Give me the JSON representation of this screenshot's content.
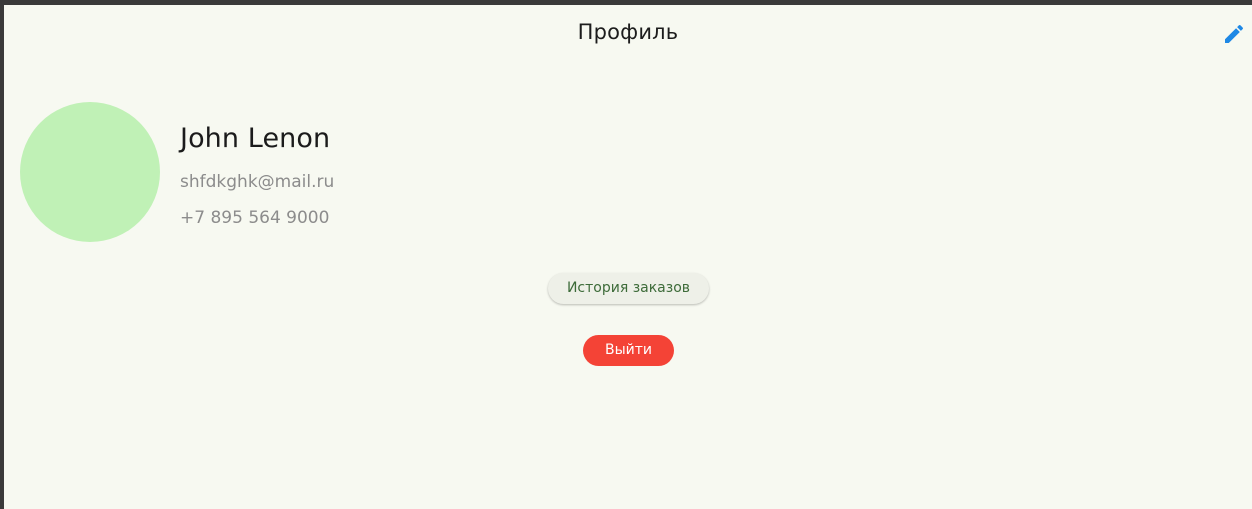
{
  "appbar": {
    "title": "Профиль",
    "edit_icon": "pencil-icon",
    "accent_color": "#1e88e5"
  },
  "profile": {
    "avatar_color": "#c0f1b6",
    "name": "John Lenon",
    "email": "shfdkghk@mail.ru",
    "phone": "+7 895 564 9000"
  },
  "actions": {
    "orders_label": "История заказов",
    "logout_label": "Выйти",
    "logout_color": "#f44336"
  }
}
